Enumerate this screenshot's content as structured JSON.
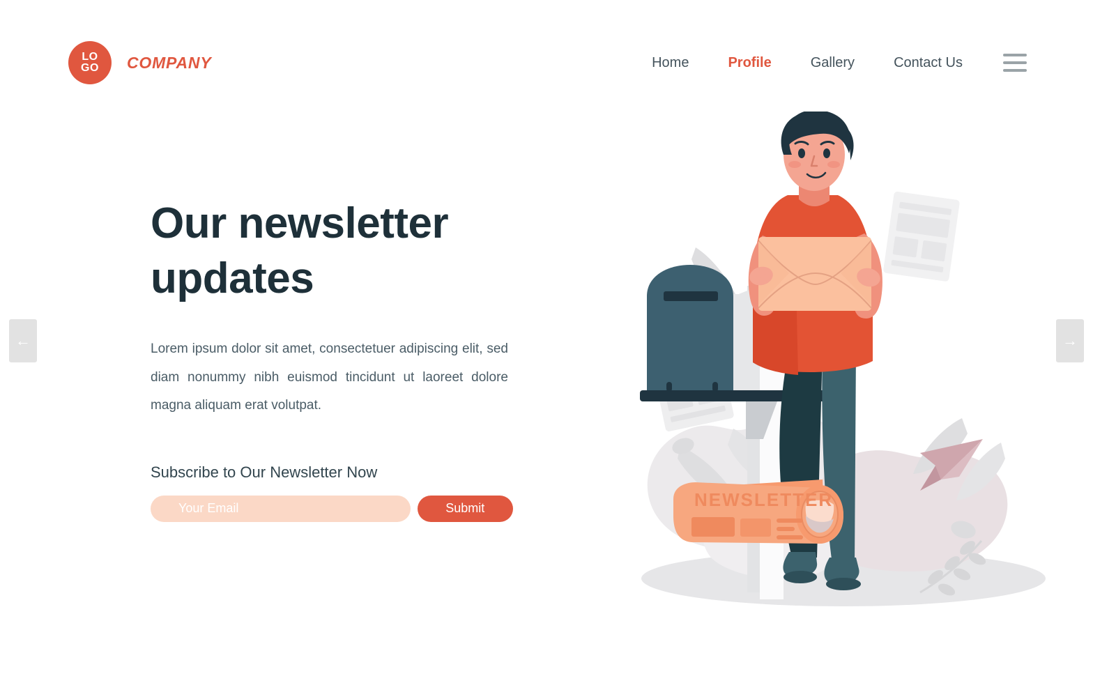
{
  "brand": {
    "logo_line1": "LO",
    "logo_line2": "GO",
    "name": "COMPANY",
    "accent_color": "#e0573f"
  },
  "nav": {
    "items": [
      {
        "label": "Home",
        "active": false
      },
      {
        "label": "Profile",
        "active": true
      },
      {
        "label": "Gallery",
        "active": false
      },
      {
        "label": "Contact Us",
        "active": false
      }
    ],
    "menu_icon": "hamburger-icon"
  },
  "hero": {
    "headline": "Our newsletter updates",
    "paragraph": "Lorem ipsum dolor sit amet, consectetuer adipiscing elit, sed diam nonummy nibh euismod tincidunt ut laoreet dolore magna aliquam erat volutpat.",
    "heading_color": "#1e3039",
    "body_color": "#4a5c66"
  },
  "subscribe": {
    "label": "Subscribe to Our Newsletter Now",
    "email_placeholder": "Your Email",
    "email_value": "",
    "submit_label": "Submit",
    "input_bg": "#fbd8c6",
    "button_bg": "#e0573f"
  },
  "carousel": {
    "prev_label": "←",
    "next_label": "→",
    "arrow_bg": "#e2e2e2"
  },
  "illustration": {
    "name": "person-holding-envelope-at-mailbox",
    "newsletter_roll_text": "NEWSLETTER",
    "colors": {
      "shirt": "#e35334",
      "skin": "#f0917d",
      "hair": "#1f3440",
      "trousers_light": "#3c626d",
      "trousers_dark": "#1d3a42",
      "mailbox": "#3d6070",
      "mailbox_dark": "#1f3440",
      "envelope": "#fbc09e",
      "newsletter": "#f7a77f",
      "newsletter_accent": "#ef8a5e",
      "blob_gray": "#eceaec",
      "blob_pink": "#e9e0e3",
      "paper_plane_pink": "#cfa6ad",
      "post_white": "#f7f7f8",
      "post_shadow": "#c9ccd0",
      "ground_shadow": "#e6e6e8"
    }
  }
}
